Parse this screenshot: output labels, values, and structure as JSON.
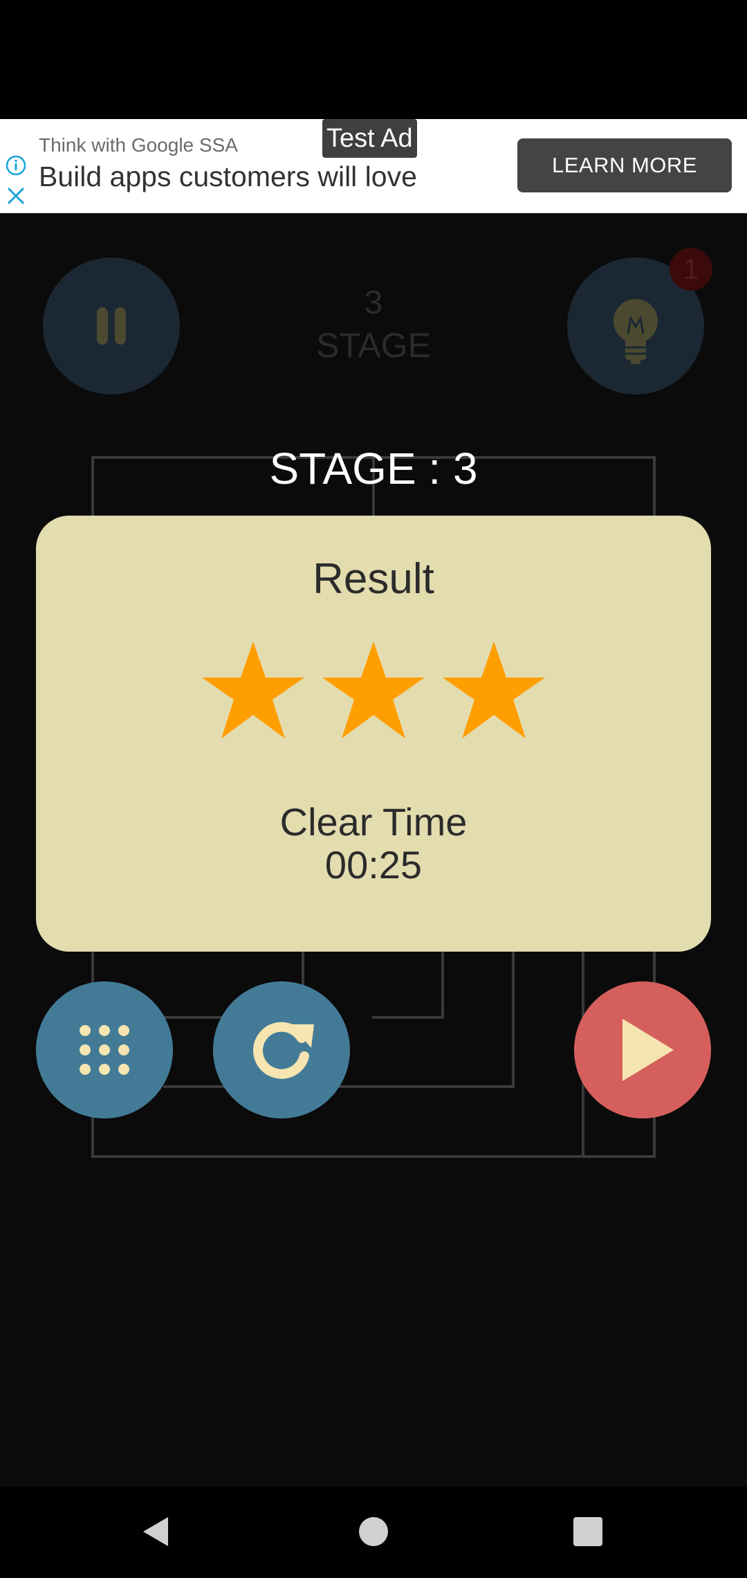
{
  "ad": {
    "label": "Test Ad",
    "advertiser": "Think with Google SSA",
    "headline": "Build apps customers will love",
    "cta": "LEARN MORE"
  },
  "header": {
    "stage_number": "3",
    "stage_word": "STAGE",
    "hint_count": "1"
  },
  "stage_title": "STAGE : 3",
  "result": {
    "title": "Result",
    "stars_earned": 3,
    "stars_total": 3,
    "clear_time_label": "Clear Time",
    "clear_time_value": "00:25"
  },
  "icons": {
    "pause": "pause-icon",
    "hint": "lightbulb-icon",
    "menu": "grid-icon",
    "retry": "refresh-icon",
    "next": "play-icon"
  },
  "colors": {
    "card_bg": "#e3dcaf",
    "star": "#ff9e00",
    "blue_button": "#437b97",
    "red_button": "#d55f5c",
    "icon_cream": "#f6e5b0"
  }
}
